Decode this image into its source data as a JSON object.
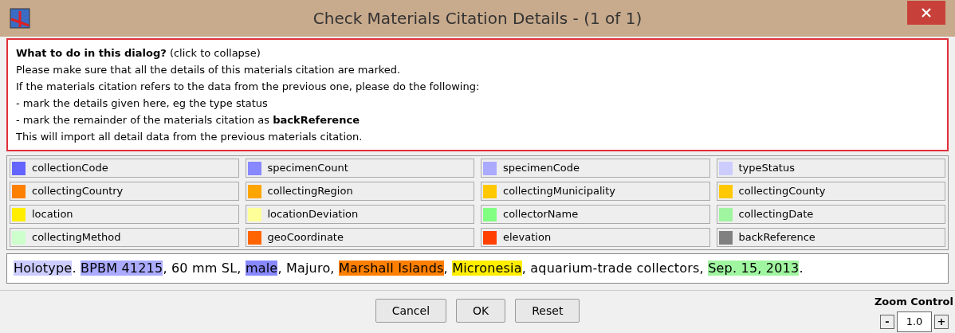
{
  "window": {
    "title": "Check Materials Citation Details - (1 of 1)"
  },
  "help": {
    "lines": [
      "**What to do in this dialog?** (click to collapse)",
      "Please make sure that all the details of this materials citation are marked.",
      "If the materials citation refers to the data from the previous one, please do the following:",
      "- mark the details given here, eg the type status",
      "- mark the remainder of the materials citation as **backReference**",
      "This will import all detail data from the previous materials citation."
    ]
  },
  "legend": [
    {
      "label": "collectionCode",
      "color": "#6464ff"
    },
    {
      "label": "specimenCount",
      "color": "#8888ff"
    },
    {
      "label": "specimenCode",
      "color": "#aaaaff"
    },
    {
      "label": "typeStatus",
      "color": "#ccccff"
    },
    {
      "label": "collectingCountry",
      "color": "#ff8000"
    },
    {
      "label": "collectingRegion",
      "color": "#ffa500"
    },
    {
      "label": "collectingMunicipality",
      "color": "#ffc800"
    },
    {
      "label": "collectingCounty",
      "color": "#ffc801"
    },
    {
      "label": "location",
      "color": "#ffee00"
    },
    {
      "label": "locationDeviation",
      "color": "#ffff99"
    },
    {
      "label": "collectorName",
      "color": "#80ff80"
    },
    {
      "label": "collectingDate",
      "color": "#a0f5a0"
    },
    {
      "label": "collectingMethod",
      "color": "#ccffcc"
    },
    {
      "label": "geoCoordinate",
      "color": "#ff6400"
    },
    {
      "label": "elevation",
      "color": "#ff4000"
    },
    {
      "label": "backReference",
      "color": "#808080"
    }
  ],
  "citation": [
    {
      "text": "Holotype",
      "color": "#ccccff"
    },
    {
      "text": ". "
    },
    {
      "text": "BPBM 41215",
      "color": "#aaaaff"
    },
    {
      "text": ", 60 mm SL, "
    },
    {
      "text": "male",
      "color": "#8888ff"
    },
    {
      "text": ", Majuro, "
    },
    {
      "text": "Marshall Islands",
      "color": "#ff8000"
    },
    {
      "text": ", "
    },
    {
      "text": "Micronesia",
      "color": "#ffee00"
    },
    {
      "text": ", aquarium-trade collectors, "
    },
    {
      "text": "Sep. 15, 2013",
      "color": "#a0f5a0"
    },
    {
      "text": "."
    }
  ],
  "buttons": [
    "Cancel",
    "OK",
    "Reset"
  ],
  "zoom_control": {
    "title": "Zoom Control",
    "minus": "-",
    "value": "1.0",
    "plus": "+"
  }
}
